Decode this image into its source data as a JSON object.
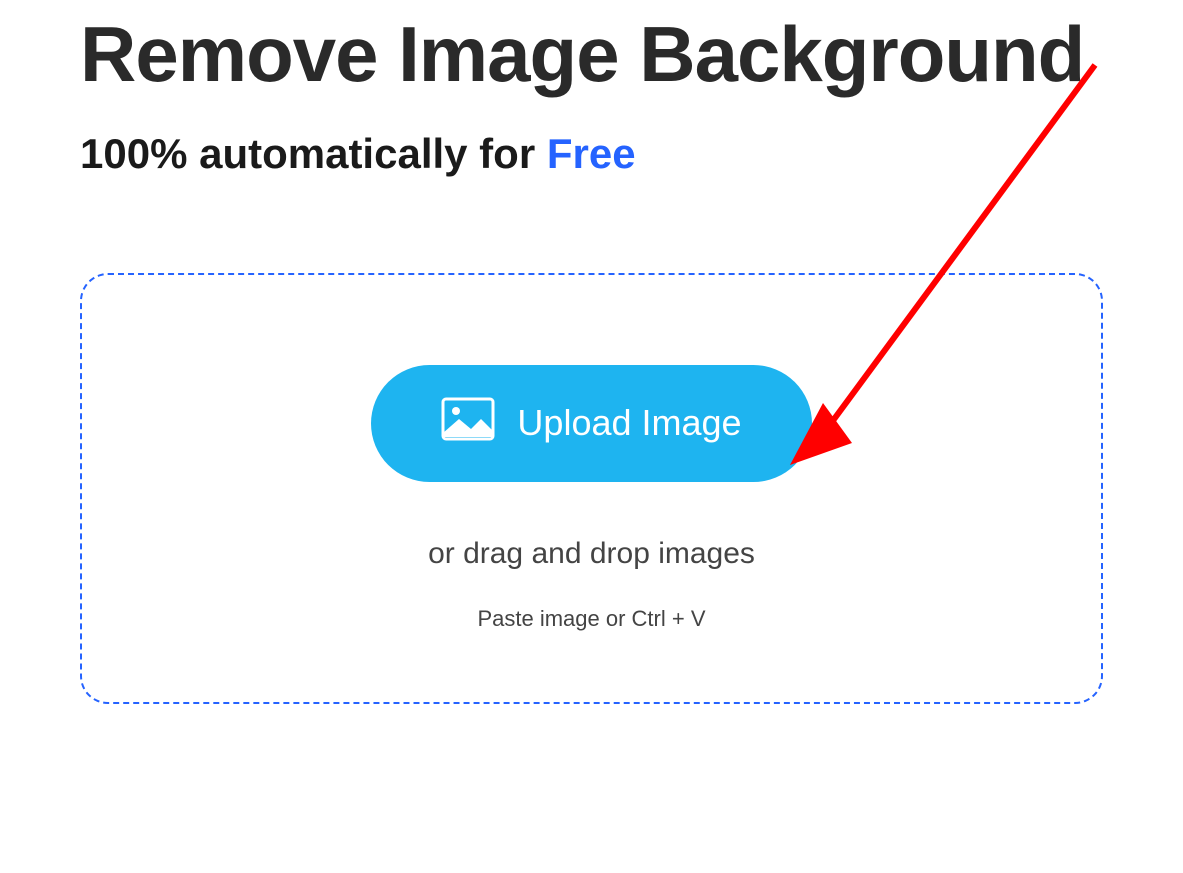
{
  "hero": {
    "title": "Remove Image Background",
    "subtitle_prefix": "100% automatically for ",
    "subtitle_highlight": "Free"
  },
  "upload": {
    "button_label": "Upload Image",
    "drag_text": "or drag and drop images",
    "paste_text": "Paste image or Ctrl + V"
  },
  "colors": {
    "accent_blue": "#2563ff",
    "button_blue": "#1eb4f0",
    "annotation_red": "#ff0000"
  }
}
